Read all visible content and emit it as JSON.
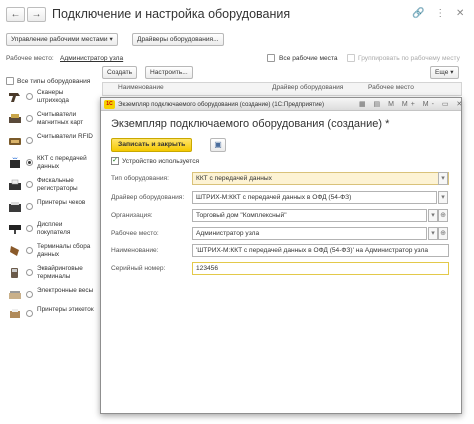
{
  "window": {
    "title": "Подключение и настройка оборудования",
    "back": "←",
    "forward": "→",
    "actions_icons": "🔗 ⋮ ✕"
  },
  "toolbar": {
    "workplaces_button": "Управление рабочими местами",
    "drivers_button": "Драйверы оборудования..."
  },
  "workplace": {
    "label": "Рабочее место:",
    "value": "Администратор узла",
    "all_workplaces": "Все рабочие места",
    "group_by_workplace": "Группировать по рабочему месту"
  },
  "sidebar": {
    "all_types": "Все типы оборудования",
    "items": [
      {
        "label": "Сканеры штрихкода",
        "icon": "barcode-scanner-icon",
        "selected": false
      },
      {
        "label": "Считыватели магнитных карт",
        "icon": "card-reader-icon",
        "selected": false
      },
      {
        "label": "Считыватели RFID",
        "icon": "rfid-reader-icon",
        "selected": false
      },
      {
        "label": "ККТ с передачей данных",
        "icon": "cash-register-icon",
        "selected": true
      },
      {
        "label": "Фискальные регистраторы",
        "icon": "fiscal-printer-icon",
        "selected": false
      },
      {
        "label": "Принтеры чеков",
        "icon": "receipt-printer-icon",
        "selected": false
      },
      {
        "label": "Дисплеи покупателя",
        "icon": "customer-display-icon",
        "selected": false
      },
      {
        "label": "Терминалы сбора данных",
        "icon": "data-terminal-icon",
        "selected": false
      },
      {
        "label": "Эквайринговые терминалы",
        "icon": "acquiring-terminal-icon",
        "selected": false
      },
      {
        "label": "Электронные весы",
        "icon": "scales-icon",
        "selected": false
      },
      {
        "label": "Принтеры этикеток",
        "icon": "label-printer-icon",
        "selected": false
      }
    ]
  },
  "list": {
    "create_button": "Создать",
    "configure_button": "Настроить...",
    "more_button": "Еще",
    "columns": [
      "Наименование",
      "Драйвер оборудования",
      "Рабочее место"
    ]
  },
  "modal": {
    "titlebar": "Экземпляр подключаемого оборудования (создание)  (1С:Предприятие)",
    "logo": "1С",
    "titlebar_icons": "▦ ▤ M M+ M- ▭ ✕",
    "heading": "Экземпляр подключаемого оборудования (создание) *",
    "save_close": "Записать и закрыть",
    "save_icon": "▣",
    "device_used": "Устройство используется",
    "fields": {
      "type_label": "Тип оборудования:",
      "type_value": "ККТ с передачей данных",
      "driver_label": "Драйвер оборудования:",
      "driver_value": "ШТРИХ-М:ККТ с передачей данных в ОФД (54-ФЗ)",
      "org_label": "Организация:",
      "org_value": "Торговый дом \"Комплексный\"",
      "workplace_label": "Рабочее место:",
      "workplace_value": "Администратор узла",
      "name_label": "Наименование:",
      "name_value": "'ШТРИХ-М:ККТ с передачей данных в ОФД (54-ФЗ)' на Администратор узла",
      "serial_label": "Серийный номер:",
      "serial_value": "123456"
    }
  },
  "colors": {
    "accent_yellow": "#f5c900",
    "field_yellow": "#fdf3d4"
  }
}
